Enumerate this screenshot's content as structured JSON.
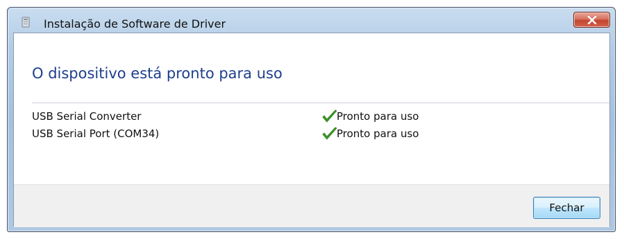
{
  "window": {
    "title": "Instalação de Software de Driver"
  },
  "main": {
    "heading": "O dispositivo está pronto para uso",
    "devices": [
      {
        "name": "USB Serial Converter",
        "status": "Pronto para uso"
      },
      {
        "name": "USB Serial Port (COM34)",
        "status": "Pronto para uso"
      }
    ]
  },
  "footer": {
    "close_label": "Fechar"
  },
  "icons": {
    "title": "driver-install-icon",
    "close": "close-icon",
    "status": "checkmark-icon"
  },
  "colors": {
    "heading": "#1e3e8c",
    "check": "#3f9a26",
    "close_button_red": "#c3452e"
  }
}
